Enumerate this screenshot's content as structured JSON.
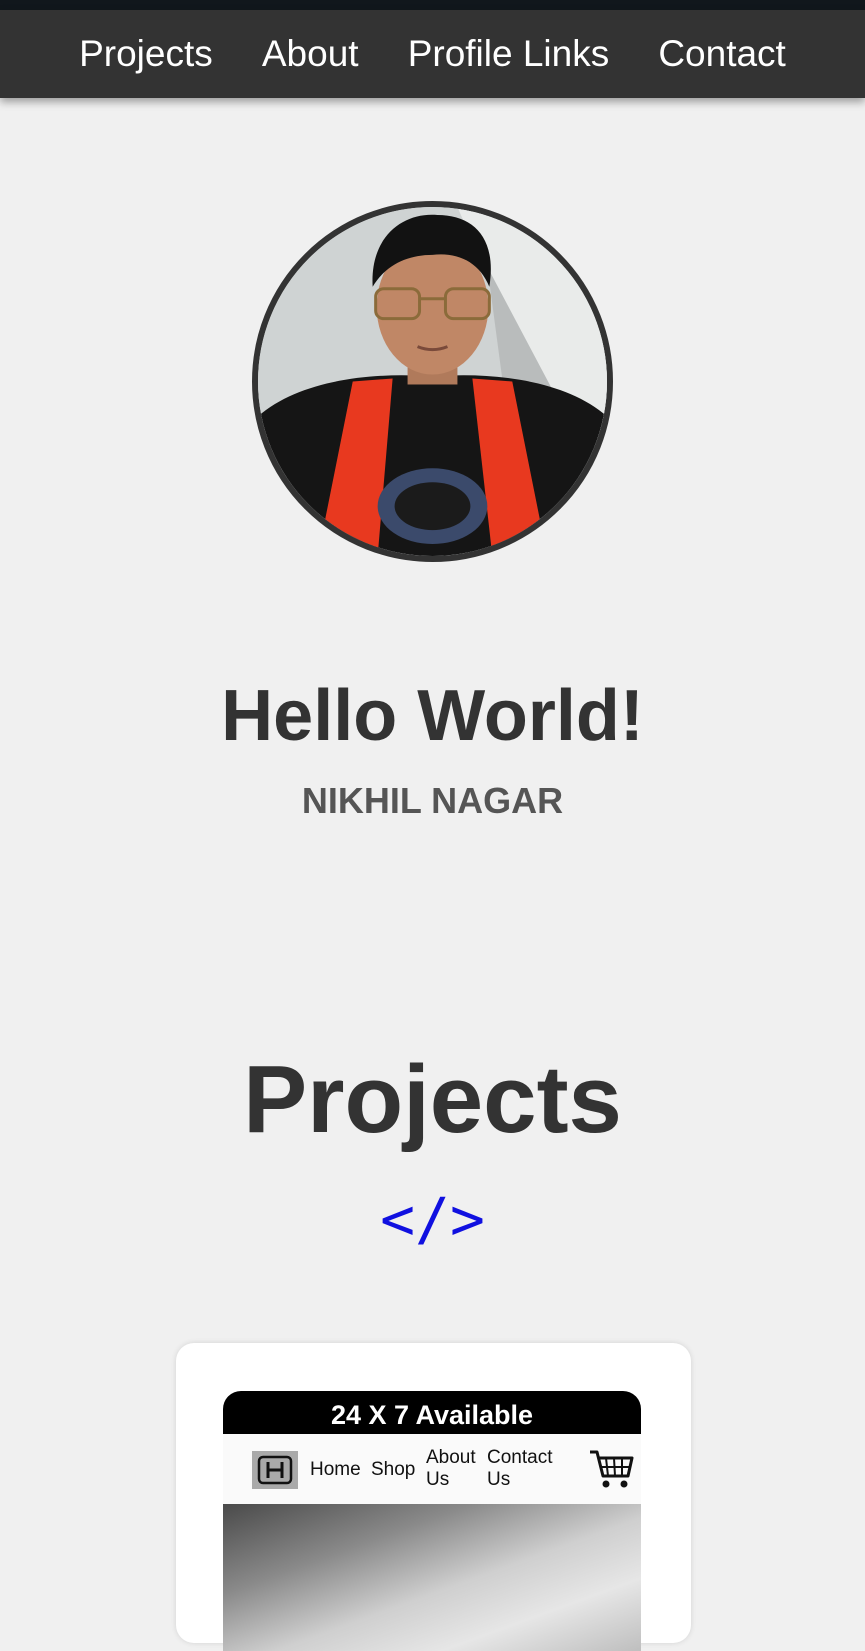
{
  "nav": {
    "items": [
      {
        "label": "Projects"
      },
      {
        "label": "About"
      },
      {
        "label": "Profile Links"
      },
      {
        "label": "Contact"
      }
    ]
  },
  "hero": {
    "greeting": "Hello World!",
    "name": "NIKHIL NAGAR"
  },
  "projects": {
    "title": "Projects",
    "icon_text": "</>",
    "card": {
      "banner": "24 X 7 Available",
      "nav": {
        "home": "Home",
        "shop": "Shop",
        "about": "About Us",
        "contact": "Contact Us"
      }
    }
  },
  "colors": {
    "nav_bg": "#333333",
    "page_bg": "#f0f0f0",
    "code_icon": "#1010e0"
  }
}
